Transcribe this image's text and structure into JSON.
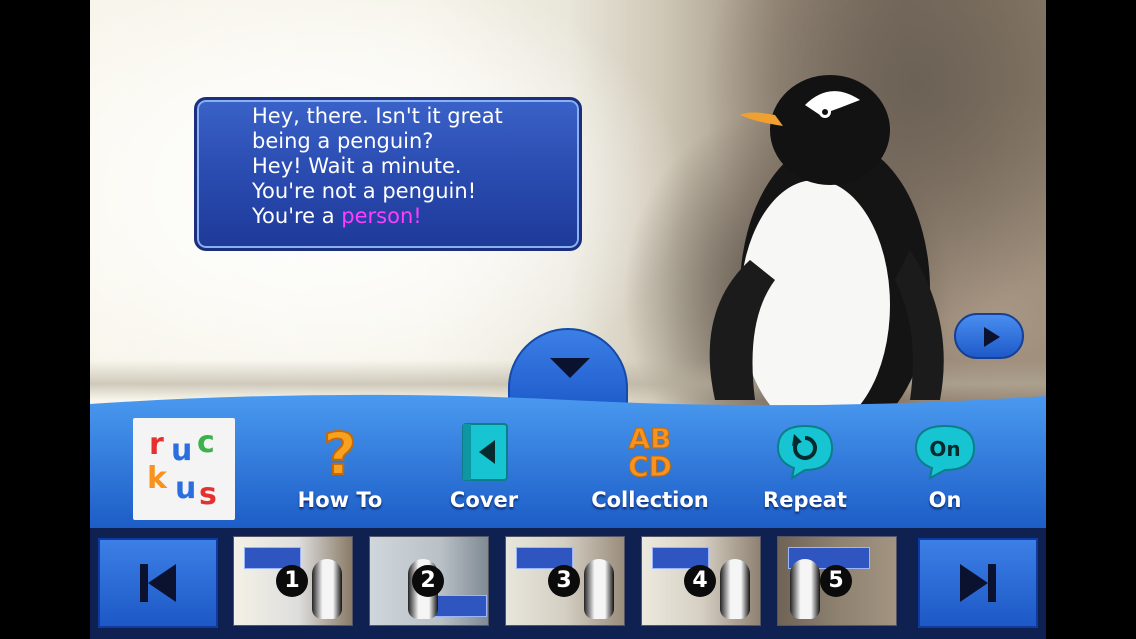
{
  "speech": {
    "lines": [
      "Hey, there. Isn't it great",
      "being a penguin?",
      "Hey! Wait a minute.",
      "You're not a penguin!",
      "You're a "
    ],
    "highlight": "person!"
  },
  "logo": {
    "letters": [
      "r",
      "u",
      "c",
      "k",
      "u",
      "s"
    ]
  },
  "toolbar": {
    "how_to": "How To",
    "cover": "Cover",
    "collection": "Collection",
    "collection_icon": "ABCD",
    "repeat": "Repeat",
    "on_label": "On",
    "on_icon": "On"
  },
  "thumbnails": [
    "1",
    "2",
    "3",
    "4",
    "5"
  ],
  "icons": {
    "how_to": "question-icon",
    "cover": "book-cover-icon",
    "repeat": "repeat-icon",
    "audio": "speech-on-icon",
    "prev": "skip-back-icon",
    "next": "skip-forward-icon"
  },
  "colors": {
    "accent": "#2a6ee0",
    "highlight": "#ff3cff",
    "orange": "#f7931e",
    "teal": "#17c4d1"
  }
}
